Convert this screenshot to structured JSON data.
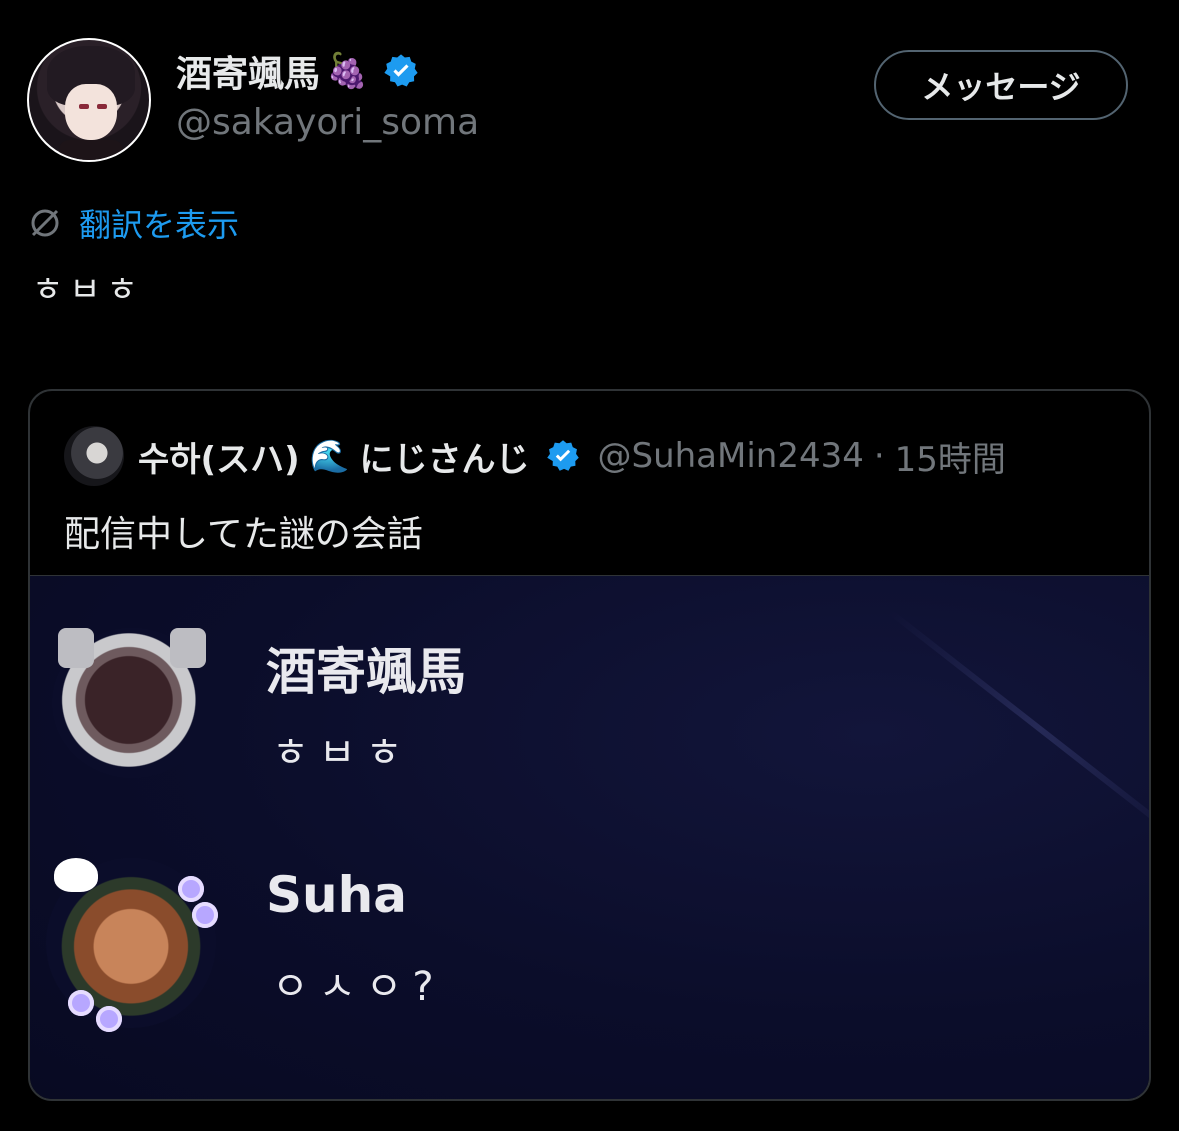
{
  "profile": {
    "display_name": "酒寄颯馬",
    "display_emoji": "🍇",
    "handle": "@sakayori_soma",
    "verified_icon": "verified-badge-icon"
  },
  "actions": {
    "message_label": "メッセージ"
  },
  "translate": {
    "label": "翻訳を表示",
    "icon": "translate-icon"
  },
  "tweet": {
    "text": "ㅎㅂㅎ"
  },
  "quote": {
    "author_name": "수하(スハ)",
    "author_emoji": "🌊",
    "author_suffix": "にじさんじ",
    "handle": "@SuhaMin2434",
    "separator": "·",
    "time": "15時間",
    "text": "配信中してた謎の会話",
    "media": {
      "messages": [
        {
          "name": "酒寄颯馬",
          "text": "ㅎㅂㅎ"
        },
        {
          "name": "Suha",
          "text": "ㅇㅅㅇ?"
        }
      ]
    }
  },
  "colors": {
    "background": "#000000",
    "link": "#1d9bf0",
    "secondary_text": "#71767b",
    "border": "#2f3336",
    "media_bg": "#0b0d2a"
  }
}
